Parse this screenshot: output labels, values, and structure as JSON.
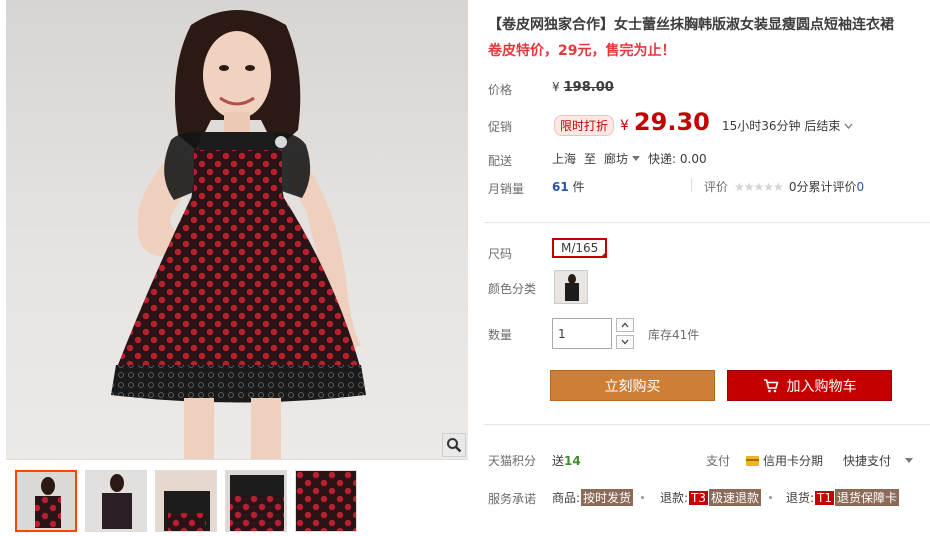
{
  "product": {
    "title": "【卷皮网独家合作】女士蕾丝抹胸韩版淑女装显瘦圆点短袖连衣裙",
    "subtitle": "卷皮特价，29元，售完为止！"
  },
  "price": {
    "label": "价格",
    "currency": "¥",
    "original": "198.00",
    "promo_label": "促销",
    "promo_tag": "限时打折",
    "promo_value": "29.30",
    "countdown": "15小时36分钟 后结束"
  },
  "shipping": {
    "label": "配送",
    "from": "上海",
    "to_word": "至",
    "destination": "廊坊",
    "express": "快递: 0.00"
  },
  "sales": {
    "label": "月销量",
    "count": "61",
    "unit": "件",
    "rating_label": "评价",
    "stars": "★★★★★",
    "reviews_count": "0",
    "reviews_text": "分累计评价",
    "reviews_num": "0"
  },
  "options": {
    "size_label": "尺码",
    "size_value": "M/165",
    "color_label": "颜色分类",
    "qty_label": "数量",
    "qty_value": "1",
    "stock": "库存41件"
  },
  "buttons": {
    "buy": "立刻购买",
    "cart": "加入购物车"
  },
  "extras": {
    "points_label": "天猫积分",
    "points_prefix": "送",
    "points_value": "14",
    "pay_label": "支付",
    "pay_card": "信用卡分期",
    "pay_quick": "快捷支付",
    "service_label": "服务承诺",
    "svc1_prefix": "商品:",
    "svc1_tag": "按时发货",
    "svc2_prefix": "退款:",
    "svc2_code": "T3",
    "svc2_tag": "极速退款",
    "svc3_prefix": "退货:",
    "svc3_code": "T1",
    "svc3_tag": "退货保障卡"
  },
  "colors": {
    "accent_red": "#c40000",
    "buy_orange": "#cf7f35",
    "link_blue": "#2953a6",
    "points_green": "#3f8e2e"
  },
  "icons": [
    "zoom-icon",
    "cart-icon",
    "chevron-down-icon",
    "credit-card-icon",
    "caret-down-icon"
  ]
}
